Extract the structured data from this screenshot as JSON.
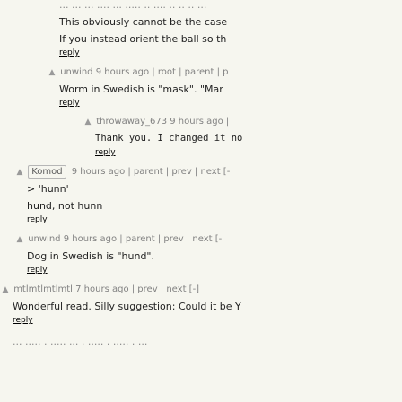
{
  "reply_label": "reply",
  "comments": [
    {
      "head_text": "",
      "text_lines": [
        "This obviously cannot be the case",
        "If you instead orient the ball so th"
      ],
      "top_line": "... ... ... .... ... ..... .. .... .. .. .. ..."
    },
    {
      "user": "unwind",
      "head_rest": "9 hours ago | root | parent | p",
      "text": "Worm in Swedish is \"mask\". \"Mar"
    },
    {
      "user": "throwaway_673",
      "head_rest": "9 hours ago |",
      "text": "Thank you. I changed it no"
    },
    {
      "user": "Komod",
      "head_rest": "9 hours ago | parent | prev | next [-",
      "text_lines": [
        "> 'hunn'",
        "hund, not hunn"
      ]
    },
    {
      "user": "unwind",
      "head_rest": "9 hours ago | parent | prev | next [-",
      "text": "Dog in Swedish is \"hund\"."
    },
    {
      "user": "mtlmtlmtlmtl",
      "head_rest": "7 hours ago | prev | next [-]",
      "text": "Wonderful read. Silly suggestion: Could it be Y"
    }
  ]
}
